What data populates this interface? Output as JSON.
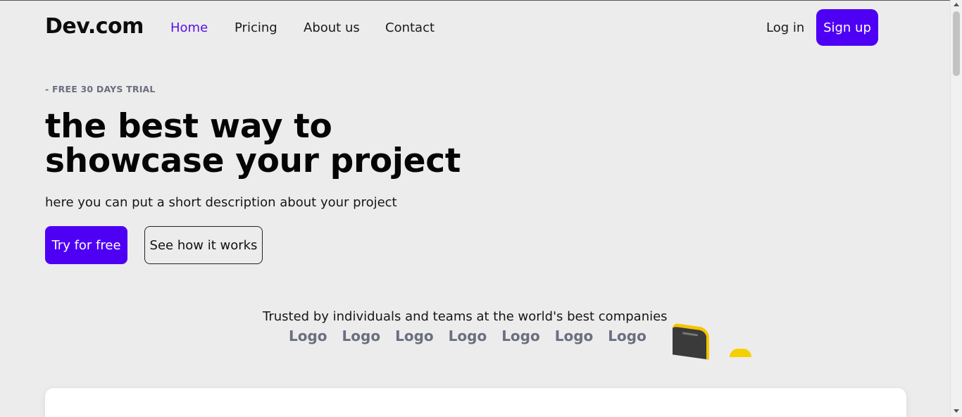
{
  "brand": "Dev.com",
  "nav": {
    "items": [
      {
        "label": "Home",
        "active": true
      },
      {
        "label": "Pricing",
        "active": false
      },
      {
        "label": "About us",
        "active": false
      },
      {
        "label": "Contact",
        "active": false
      }
    ],
    "login_label": "Log in",
    "signup_label": "Sign up"
  },
  "hero": {
    "eyebrow": "- FREE 30 DAYS TRIAL",
    "headline_line1": "the best way to",
    "headline_line2": "showcase your project",
    "description": "here you can put a short description about your project",
    "primary_cta": "Try for free",
    "secondary_cta": "See how it works"
  },
  "trusted": {
    "text": "Trusted by individuals and teams at the world's best companies",
    "logos": [
      "Logo",
      "Logo",
      "Logo",
      "Logo",
      "Logo",
      "Logo",
      "Logo"
    ]
  },
  "colors": {
    "accent": "#4e00f5",
    "background": "#ececed",
    "muted_text": "#6b6f7e"
  },
  "icons": {
    "illustration_phone": "phone-illustration-icon",
    "illustration_dot": "yellow-circle-icon"
  }
}
